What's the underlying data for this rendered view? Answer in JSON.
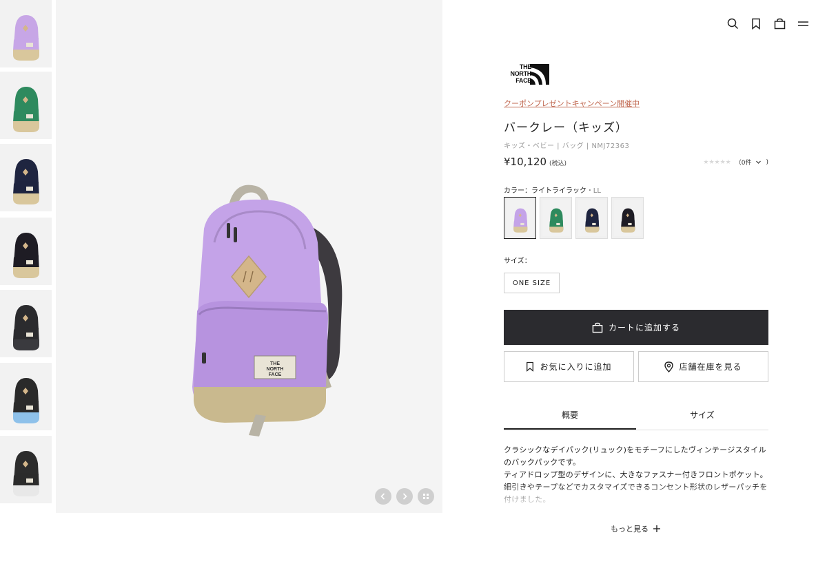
{
  "brand": {
    "logo_text": "THE\nNORTH\nFACE"
  },
  "header": {
    "icons": [
      "search-icon",
      "bookmark-icon",
      "bag-icon",
      "menu-icon"
    ]
  },
  "gallery": {
    "thumbnails": [
      {
        "color": "#c7a6e6",
        "accent": "#d9c79c"
      },
      {
        "color": "#2e8a5e",
        "accent": "#d9c79c"
      },
      {
        "color": "#1f2540",
        "accent": "#d9c79c"
      },
      {
        "color": "#1e1c24",
        "accent": "#d9c79c"
      },
      {
        "color": "#2b2b2e",
        "accent": "#3a3a3e"
      },
      {
        "color": "#2a2a2a",
        "accent": "#8ec1ea"
      },
      {
        "color": "#2c2c2c",
        "accent": "#e8e8e8"
      }
    ],
    "main_color": "#c4a3e8"
  },
  "product": {
    "campaign_link": "クーポンプレゼントキャンペーン開催中",
    "name": "バークレー（キッズ）",
    "meta": "キッズ・ベビー | バッグ | NMJ72363",
    "price": "¥10,120",
    "tax_note": "(税込)",
    "rating_stars": "★★★★★",
    "rating_count": "（0件",
    "color_label": "カラー：ライトライラック",
    "color_code": "・LL",
    "swatches": [
      {
        "color": "#c4a3e8",
        "selected": true
      },
      {
        "color": "#2e8a5e",
        "selected": false
      },
      {
        "color": "#1f2540",
        "selected": false
      },
      {
        "color": "#1e1c24",
        "selected": false
      }
    ],
    "size_label": "サイズ：",
    "size_option": "ONE SIZE",
    "cart_button": "カートに追加する",
    "favorite_button": "お気に入りに追加",
    "store_button": "店舗在庫を見る",
    "tabs": [
      "概要",
      "サイズ"
    ],
    "description": [
      "クラシックなデイパック(リュック)をモチーフにしたヴィンテージスタイルのバックパックです。",
      "ティアドロップ型のデザインに、大きなファスナー付きフロントポケット。細引きやテープなどでカスタマイズできるコンセント形状のレザーパッチを付けました。"
    ],
    "more_link": "もっと見る"
  }
}
